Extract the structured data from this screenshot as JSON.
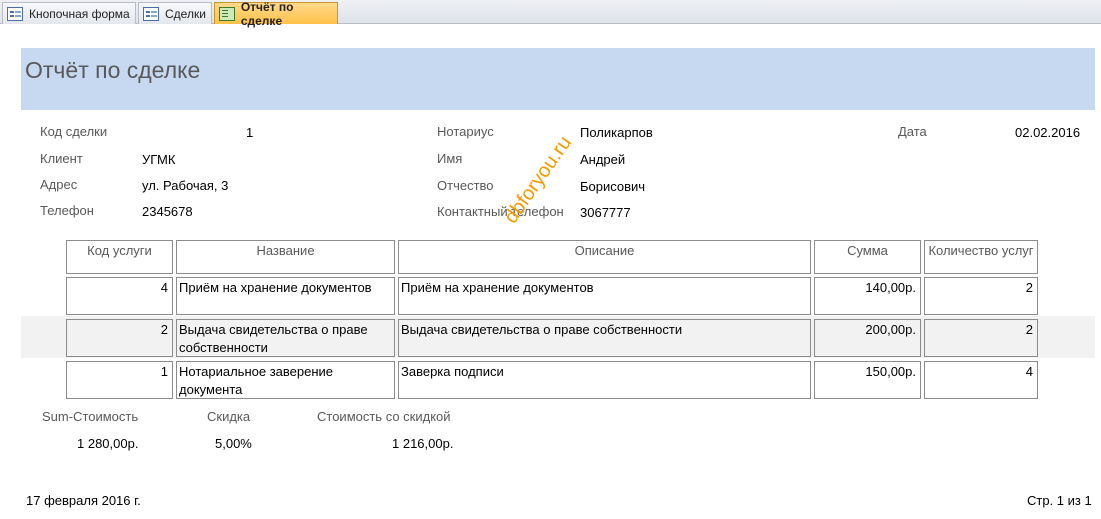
{
  "tabs": [
    {
      "label": "Кнопочная форма"
    },
    {
      "label": "Сделки"
    },
    {
      "label": "Отчёт по сделке"
    }
  ],
  "report": {
    "title": "Отчёт по сделке",
    "fields": {
      "deal_code_label": "Код сделки",
      "deal_code": "1",
      "client_label": "Клиент",
      "client": "УГМК",
      "address_label": "Адрес",
      "address": "ул. Рабочая, 3",
      "phone_label": "Телефон",
      "phone": "2345678",
      "notary_label": "Нотариус",
      "notary": "Поликарпов",
      "name_label": "Имя",
      "name": "Андрей",
      "patronymic_label": "Отчество",
      "patronymic": "Борисович",
      "contact_phone_label": "Контактный телефон",
      "contact_phone": "3067777",
      "date_label": "Дата",
      "date": "02.02.2016"
    },
    "table": {
      "headers": [
        "Код услуги",
        "Название",
        "Описание",
        "Сумма",
        "Количество услуг"
      ],
      "rows": [
        {
          "code": "4",
          "name": "Приём на хранение документов",
          "description": "Приём на хранение документов",
          "sum": "140,00р.",
          "qty": "2"
        },
        {
          "code": "2",
          "name": "Выдача свидетельства о праве собственности",
          "description": "Выдача свидетельства о праве собственности",
          "sum": "200,00р.",
          "qty": "2"
        },
        {
          "code": "1",
          "name": "Нотариальное заверение документа",
          "description": "Заверка подписи",
          "sum": "150,00р.",
          "qty": "4"
        }
      ]
    },
    "totals": {
      "sum_label": "Sum-Стоимость",
      "sum": "1 280,00р.",
      "discount_label": "Скидка",
      "discount": "5,00%",
      "discounted_label": "Стоимость со скидкой",
      "discounted": "1 216,00р."
    },
    "footer": {
      "date": "17 февраля 2016 г.",
      "page": "Стр. 1 из 1"
    },
    "watermark": "dbforyou.ru"
  }
}
